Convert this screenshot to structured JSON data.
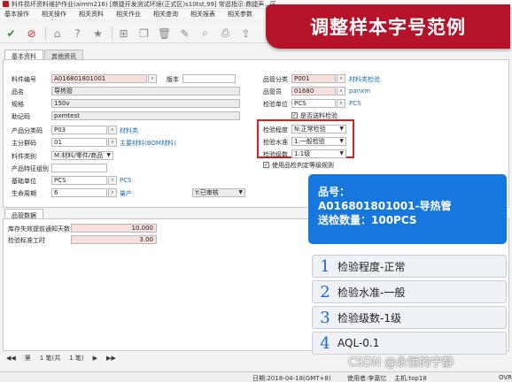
{
  "window": {
    "title": "料件损坏资料维护作业(aimm216)  [鼎捷开发测试环境(正式区)s10tst,99]  常逛指示:鼎捷声...区..."
  },
  "menu": [
    "基本操作",
    "相关操作",
    "相关资料",
    "相关作业",
    "相关查询",
    "相关报表",
    "相关参数"
  ],
  "toolbar": {
    "icons": [
      "confirm-icon",
      "cancel-icon",
      "home-icon",
      "help-icon",
      "favorite-icon",
      "new-icon",
      "copy-icon",
      "delete-icon",
      "edit-icon",
      "query-icon",
      "print-icon",
      "export-icon"
    ]
  },
  "banner": {
    "text": "调整样本字号范例",
    "color": "#b5132a"
  },
  "tabs": [
    "基本资料",
    "其他资讯"
  ],
  "form_left": {
    "item_no": {
      "label": "料件编号",
      "value": "A016801801001"
    },
    "version": {
      "label": "版本",
      "value": ""
    },
    "name": {
      "label": "品名",
      "value": "导热管"
    },
    "spec": {
      "label": "规格",
      "value": "150v"
    },
    "mnemonic": {
      "label": "助记码",
      "value": "pxmtest"
    },
    "category": {
      "label": "产品分类码",
      "value": "P03",
      "link": "材料类"
    },
    "group": {
      "label": "主分群码",
      "value": "01",
      "link": "主要材料(BOM材料)"
    },
    "item_type": {
      "label": "料件类别",
      "value": "M:材料/零件/商品"
    },
    "feature_group": {
      "label": "产品特征组别",
      "value": ""
    },
    "base_unit": {
      "label": "基础单位",
      "value": "PCS",
      "link": "PCS"
    },
    "life_cycle": {
      "label": "生命周期",
      "value": "6",
      "link": "量产",
      "status": "Y:已审核"
    }
  },
  "form_right": {
    "qc_category": {
      "label": "品管分类",
      "value": "P001",
      "link": "材料类检验"
    },
    "qc_staff": {
      "label": "品管员",
      "value": "01680",
      "link": "panxm"
    },
    "inspect_unit": {
      "label": "检验单位",
      "value": "PCS",
      "link": "PCS"
    },
    "need_inspect": {
      "label": "是否送料检验",
      "checked": true
    },
    "inspect_level": {
      "label": "检验程度",
      "value": "N:正常检验"
    },
    "inspect_standard": {
      "label": "检验水准",
      "value": "1:一般检验"
    },
    "inspect_grade": {
      "label": "检验级数",
      "value": "1:1级"
    },
    "use_rules": {
      "label": "使用品检判定等级规则",
      "checked": true
    }
  },
  "subtab": {
    "label": "品管数据"
  },
  "grid": {
    "rows": [
      {
        "label": "库存失效提前通知天数",
        "value": "10.000"
      },
      {
        "label": "检验标准工时",
        "value": "3.00"
      }
    ]
  },
  "info_card": {
    "line1": "品号：",
    "line2": "A016801801001-导热管",
    "line3": "送检数量：100PCS",
    "color": "#1678de"
  },
  "steps": [
    {
      "num": "1",
      "text": "检验程度-正常"
    },
    {
      "num": "2",
      "text": "检验水准-一般"
    },
    {
      "num": "3",
      "text": "检验级数-1级"
    },
    {
      "num": "4",
      "text": "AQL-0.1"
    }
  ],
  "pager": {
    "first": "◀◀",
    "page_label": "第",
    "current": "1 笔(共",
    "total": "1 笔)",
    "next": "▶",
    "last": "▶▶"
  },
  "status": {
    "date": "日期:2018-04-18(GMT+8)",
    "user": "使用者:李嘉忆",
    "host": "主机:top18",
    "flag": "OVR"
  },
  "watermark": "CSDN @永恒的宁静"
}
